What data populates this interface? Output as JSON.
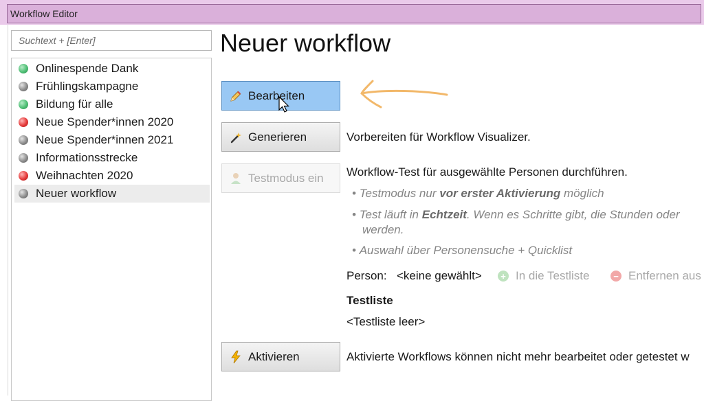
{
  "window": {
    "title": "Workflow Editor"
  },
  "search": {
    "placeholder": "Suchtext + [Enter]"
  },
  "workflows": [
    {
      "label": "Onlinespende Dank",
      "status": "green"
    },
    {
      "label": "Frühlingskampagne",
      "status": "grey"
    },
    {
      "label": "Bildung für alle",
      "status": "green"
    },
    {
      "label": "Neue Spender*innen 2020",
      "status": "red"
    },
    {
      "label": "Neue Spender*innen 2021",
      "status": "grey"
    },
    {
      "label": "Informationsstrecke",
      "status": "grey"
    },
    {
      "label": "Weihnachten 2020",
      "status": "red"
    },
    {
      "label": "Neuer workflow",
      "status": "grey",
      "selected": true
    }
  ],
  "main": {
    "title": "Neuer workflow",
    "buttons": {
      "edit": "Bearbeiten",
      "generate": "Generieren",
      "testmode": "Testmodus ein",
      "activate": "Aktivieren"
    },
    "generate_desc": "Vorbereiten für Workflow Visualizer.",
    "test_desc": "Workflow-Test für ausgewählte Personen durchführen.",
    "bullets": {
      "b1_pre": "Testmodus nur ",
      "b1_bold": "vor erster Aktivierung",
      "b1_post": " möglich",
      "b2_pre": "Test läuft in ",
      "b2_bold": "Echtzeit",
      "b2_post": ". Wenn es Schritte gibt, die Stunden oder",
      "b2_line2": "werden.",
      "b3": "Auswahl über Personensuche + Quicklist"
    },
    "person_label": "Person:",
    "person_value": "<keine gewählt>",
    "add_to_testlist": "In die Testliste",
    "remove_from": "Entfernen aus",
    "testlist_heading": "Testliste",
    "testlist_empty": "<Testliste leer>",
    "activate_desc": "Aktivierte Workflows können nicht mehr bearbeitet oder getestet w"
  },
  "colors": {
    "titlebar": "#dab0da",
    "active_button": "#99c8f4",
    "annotation_arrow": "#f2b86a",
    "status_green": "#4fbf75",
    "status_red": "#e53b3b",
    "status_grey": "#8d8d8d"
  },
  "icons": {
    "edit": "pencil-icon",
    "generate": "wand-icon",
    "testmode": "person-icon",
    "activate": "lightning-icon",
    "add": "plus-circle-icon",
    "remove": "minus-circle-icon"
  }
}
